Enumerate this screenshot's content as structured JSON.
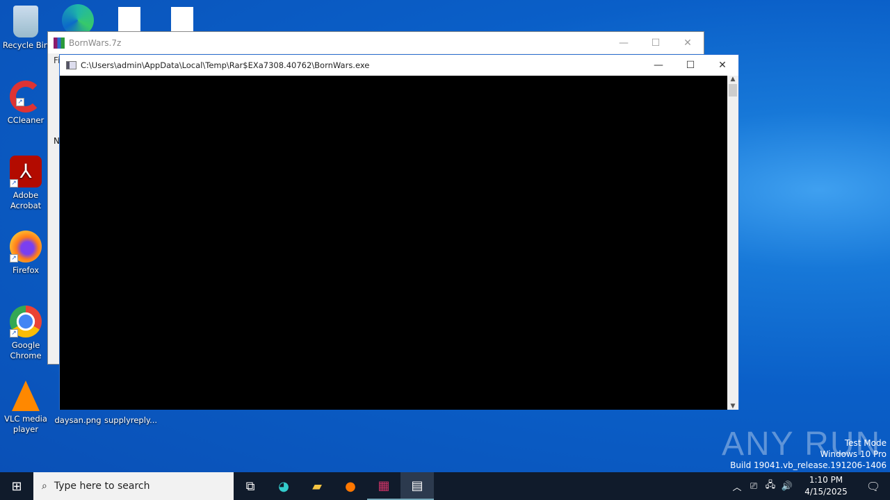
{
  "desktop": {
    "icons": [
      {
        "label": "Recycle Bin",
        "icon": "recycle-bin-icon"
      },
      {
        "label": "CCleaner",
        "icon": "ccleaner-icon"
      },
      {
        "label": "Adobe Acrobat",
        "icon": "acrobat-icon"
      },
      {
        "label": "Firefox",
        "icon": "firefox-icon"
      },
      {
        "label": "Google Chrome",
        "icon": "chrome-icon"
      },
      {
        "label": "VLC media player",
        "icon": "vlc-icon"
      },
      {
        "label": "daysan.png",
        "icon": "image-file-icon"
      },
      {
        "label": "supplyreply...",
        "icon": "image-file-icon"
      }
    ]
  },
  "winrar": {
    "title": "BornWars.7z",
    "menu_partial": "Fi",
    "col_partial": "N"
  },
  "console": {
    "title": "C:\\Users\\admin\\AppData\\Local\\Temp\\Rar$EXa7308.40762\\BornWars.exe"
  },
  "watermark": {
    "brand": "ANY RUN",
    "line1": "Test Mode",
    "line2": "Windows 10 Pro",
    "line3": "Build 19041.vb_release.191206-1406"
  },
  "taskbar": {
    "search_placeholder": "Type here to search",
    "time": "1:10 PM",
    "date": "4/15/2025"
  }
}
